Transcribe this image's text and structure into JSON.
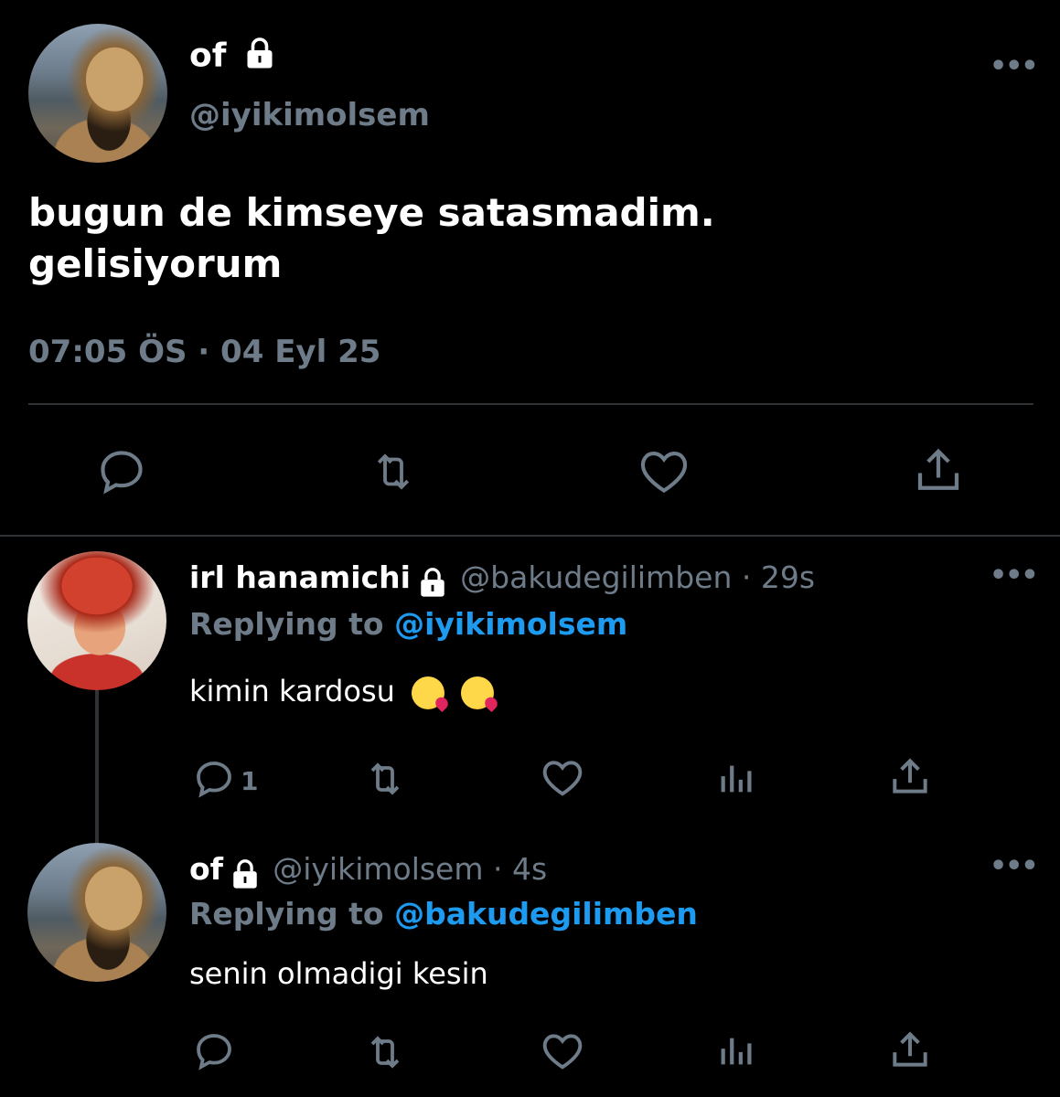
{
  "main_tweet": {
    "display_name": "of",
    "handle": "@iyikimolsem",
    "text_line1": "bugun de kimseye satasmadim.",
    "text_line2": "gelisiyorum",
    "timestamp": "07:05 ÖS · 04 Eyl 25",
    "more": "•••",
    "actions": [
      "reply-icon",
      "retweet-icon",
      "like-icon",
      "share-icon"
    ]
  },
  "reply1": {
    "display_name": "irl hanamichi",
    "handle": "@bakudegilimben · 29s",
    "replying_prefix": "Replying to",
    "replying_mention": "@iyikimolsem",
    "text": "kimin kardosu",
    "reply_count": "1",
    "more": "•••",
    "emojis": [
      "kiss-emoji",
      "kiss-emoji"
    ]
  },
  "reply2": {
    "display_name": "of",
    "handle": "@iyikimolsem · 4s",
    "replying_prefix": "Replying to",
    "replying_mention": "@bakudegilimben",
    "text": "senin olmadigi kesin",
    "more": "•••"
  },
  "colors": {
    "background": "#000000",
    "muted": "#6e7b88",
    "accent": "#1d9bf0",
    "divider": "#2f3336"
  }
}
